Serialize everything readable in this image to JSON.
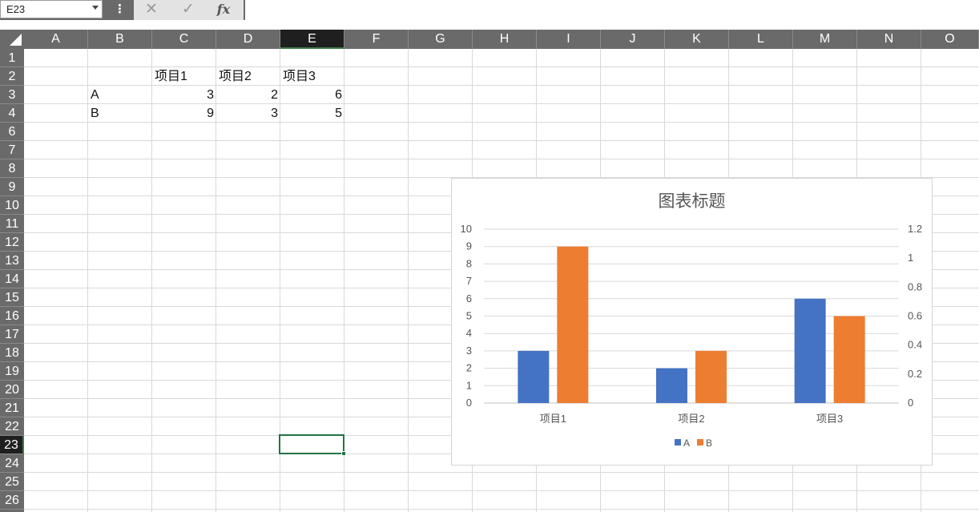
{
  "formula_bar": {
    "name_box": "E23",
    "cancel_glyph": "✕",
    "enter_glyph": "✓",
    "fx_label": "fx",
    "menu_glyph": "⋮",
    "formula_value": ""
  },
  "columns": [
    "A",
    "B",
    "C",
    "D",
    "E",
    "F",
    "G",
    "H",
    "I",
    "J",
    "K",
    "L",
    "M",
    "N",
    "O"
  ],
  "rows": [
    "1",
    "2",
    "3",
    "4",
    "6",
    "7",
    "8",
    "9",
    "10",
    "11",
    "12",
    "13",
    "14",
    "15",
    "16",
    "17",
    "18",
    "19",
    "20",
    "21",
    "22",
    "23",
    "24",
    "25",
    "26"
  ],
  "selected": {
    "column": "E",
    "row": "23"
  },
  "cells": {
    "C2": "项目1",
    "D2": "项目2",
    "E2": "项目3",
    "B3": "A",
    "C3": "3",
    "D3": "2",
    "E3": "6",
    "B4": "B",
    "C4": "9",
    "D4": "3",
    "E4": "5"
  },
  "colors": {
    "series_a": "#4472C4",
    "series_b": "#ED7D31",
    "selection": "#217346"
  },
  "chart_data": {
    "type": "bar",
    "title": "图表标题",
    "categories": [
      "项目1",
      "项目2",
      "项目3"
    ],
    "series": [
      {
        "name": "A",
        "values": [
          3,
          2,
          6
        ],
        "color": "#4472C4"
      },
      {
        "name": "B",
        "values": [
          9,
          3,
          5
        ],
        "color": "#ED7D31"
      }
    ],
    "ylim": [
      0,
      10
    ],
    "yticks": [
      "0",
      "1",
      "2",
      "3",
      "4",
      "5",
      "6",
      "7",
      "8",
      "9",
      "10"
    ],
    "y2lim": [
      0,
      1.2
    ],
    "y2ticks": [
      "0",
      "0.2",
      "0.4",
      "0.6",
      "0.8",
      "1",
      "1.2"
    ],
    "xlabel": "",
    "ylabel": "",
    "grid": true,
    "legend": "bottom"
  }
}
